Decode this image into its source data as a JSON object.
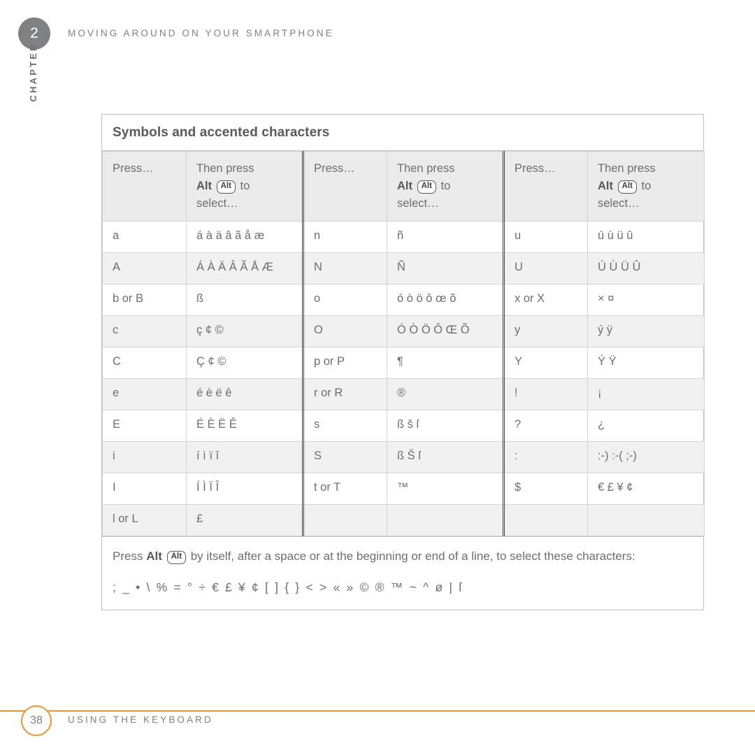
{
  "header": {
    "chapter_number": "2",
    "chapter_label": "CHAPTER",
    "running_head": "MOVING AROUND ON YOUR SMARTPHONE"
  },
  "table": {
    "title": "Symbols and accented characters",
    "headers": {
      "press": "Press…",
      "then_press_prefix": "Then press",
      "then_press_bold": "Alt",
      "alt_key_label": "Alt",
      "then_press_suffix": "to",
      "then_press_line3": "select…"
    },
    "rows": [
      {
        "c1k": "a",
        "c1v": "á à ä â ã å æ",
        "c2k": "n",
        "c2v": "ñ",
        "c3k": "u",
        "c3v": "ú ù ü û"
      },
      {
        "c1k": "A",
        "c1v": "Á À Ä Â Ã Å Æ",
        "c2k": "N",
        "c2v": "Ñ",
        "c3k": "U",
        "c3v": "Ú Ù Ü Û"
      },
      {
        "c1k": "b or B",
        "c1v": "ß",
        "c2k": "o",
        "c2v": "ó ò ö ô œ õ",
        "c3k": "x or X",
        "c3v": "× ¤"
      },
      {
        "c1k": "c",
        "c1v": "ç ¢ ©",
        "c2k": "O",
        "c2v": "Ó Ò Ö Ô Œ Õ",
        "c3k": "y",
        "c3v": "ý ÿ"
      },
      {
        "c1k": "C",
        "c1v": "Ç ¢ ©",
        "c2k": "p or P",
        "c2v": "¶",
        "c3k": "Y",
        "c3v": "Ý Ÿ"
      },
      {
        "c1k": "e",
        "c1v": "é è ë ê",
        "c2k": "r or R",
        "c2v": "®",
        "c3k": "!",
        "c3v": "¡"
      },
      {
        "c1k": "E",
        "c1v": "É È Ë Ê",
        "c2k": "s",
        "c2v": "ß š ſ",
        "c3k": "?",
        "c3v": "¿"
      },
      {
        "c1k": "i",
        "c1v": "í ì ï î",
        "c2k": "S",
        "c2v": "ß Š ſ",
        "c3k": ":",
        "c3v": ":-) :-( ;-)"
      },
      {
        "c1k": "I",
        "c1v": "Í Ì Ï Î",
        "c2k": "t or T",
        "c2v": "™",
        "c3k": "$",
        "c3v": "€ £ ¥ ¢"
      },
      {
        "c1k": "l or L",
        "c1v": "£",
        "c2k": "",
        "c2v": "",
        "c3k": "",
        "c3v": ""
      }
    ],
    "note": {
      "prefix": "Press",
      "bold": "Alt",
      "alt_key_label": "Alt",
      "suffix": "by itself, after a space or at the beginning or end of a line, to select these characters:",
      "symbols": "; _ • \\ % = ° ÷ €  £ ¥ ¢ [ ] { } < > « » © ® ™ ~ ^ ø | ſ"
    }
  },
  "footer": {
    "page_number": "38",
    "section": "USING THE KEYBOARD"
  },
  "colors": {
    "accent_orange": "#f1942c",
    "chapter_gray": "#808184",
    "text_gray": "#6d6e71",
    "band_gray": "#f1f1f2",
    "header_gray": "#ebebec"
  }
}
